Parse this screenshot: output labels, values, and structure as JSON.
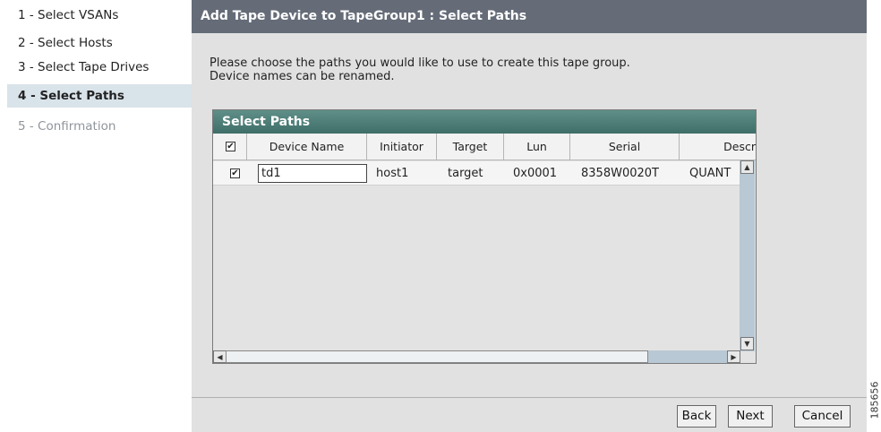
{
  "wizard": {
    "steps": [
      {
        "label": "1 - Select VSANs",
        "state": "done"
      },
      {
        "label": "2 - Select Hosts",
        "state": "done"
      },
      {
        "label": "3 - Select Tape Drives",
        "state": "done"
      },
      {
        "label": "4 - Select Paths",
        "state": "active"
      },
      {
        "label": "5 - Confirmation",
        "state": "disabled"
      }
    ]
  },
  "title": "Add Tape Device to TapeGroup1 : Select Paths",
  "instructions": {
    "line1": "Please choose the paths you would like to use to create this tape group.",
    "line2": "Device names can be renamed."
  },
  "paths_panel": {
    "header": "Select Paths",
    "select_all_checked": true,
    "columns": [
      "Device Name",
      "Initiator",
      "Target",
      "Lun",
      "Serial",
      "Descr"
    ],
    "rows": [
      {
        "checked": true,
        "device_name": "td1",
        "initiator": "host1",
        "target": "target",
        "lun": "0x0001",
        "serial": "8358W0020T",
        "description": "QUANT"
      }
    ]
  },
  "buttons": {
    "back": "Back",
    "next": "Next",
    "cancel": "Cancel"
  },
  "figure_id": "185656",
  "colors": {
    "title_bar": "#656c78",
    "panel_header": "#4f7f78",
    "active_step": "#d9e3ea",
    "background": "#e1e1e1"
  }
}
